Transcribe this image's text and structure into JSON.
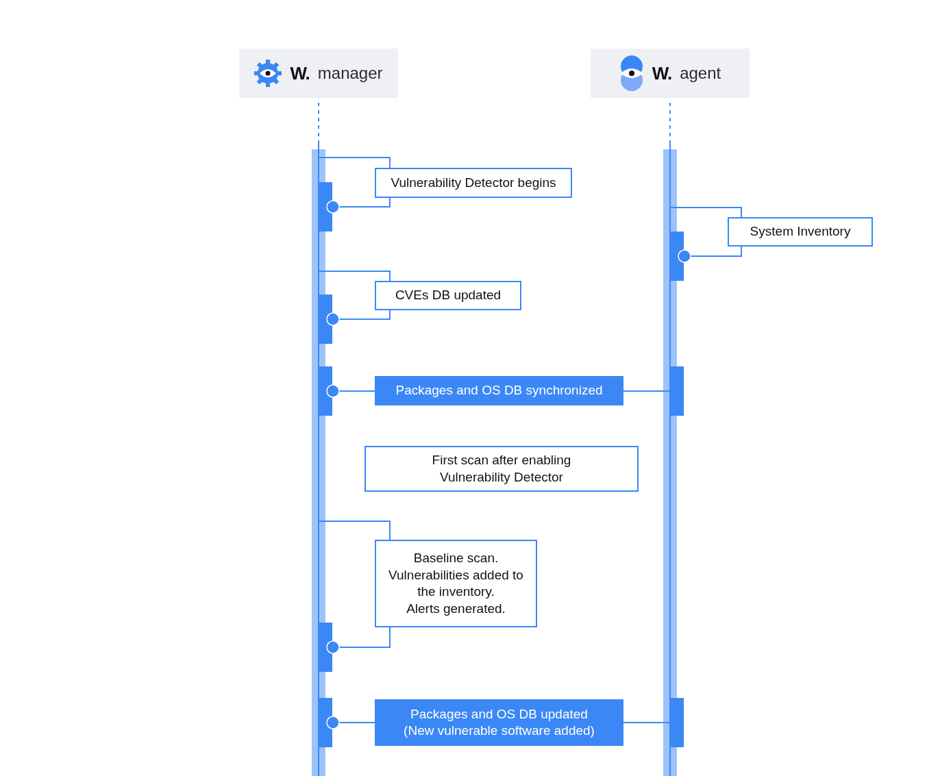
{
  "participants": [
    {
      "brand": "W.",
      "name": "manager"
    },
    {
      "brand": "W.",
      "name": "agent"
    }
  ],
  "messages": [
    {
      "kind": "self",
      "agent_side": false,
      "lines": [
        "Vulnerability Detector begins"
      ]
    },
    {
      "kind": "self",
      "agent_side": true,
      "lines": [
        "System Inventory"
      ]
    },
    {
      "kind": "self",
      "agent_side": false,
      "lines": [
        "CVEs DB updated"
      ]
    },
    {
      "kind": "sync",
      "lines": [
        "Packages and OS DB synchronized"
      ]
    },
    {
      "kind": "note",
      "lines": [
        "First scan after enabling",
        "Vulnerability Detector"
      ]
    },
    {
      "kind": "self",
      "agent_side": false,
      "lines": [
        "Baseline scan.",
        "Vulnerabilities added to",
        "the inventory.",
        "Alerts generated."
      ]
    },
    {
      "kind": "sync",
      "lines": [
        "Packages and OS DB updated",
        "(New vulnerable software added)"
      ]
    }
  ]
}
